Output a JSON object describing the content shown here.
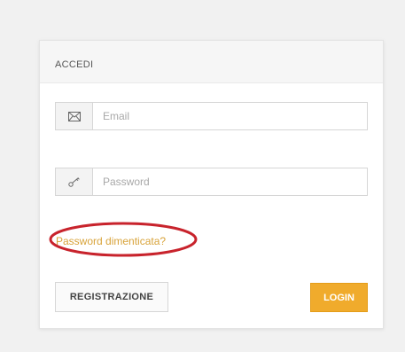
{
  "panel": {
    "title": "ACCEDI"
  },
  "email": {
    "icon": "envelope-icon",
    "placeholder": "Email"
  },
  "password": {
    "icon": "key-icon",
    "placeholder": "Password"
  },
  "forgot": {
    "label": "Password dimenticata?",
    "highlight_color": "#c8232c",
    "link_color": "#d8a33a"
  },
  "buttons": {
    "register_label": "REGISTRAZIONE",
    "login_label": "LOGIN",
    "login_color": "#f0ab2c"
  }
}
